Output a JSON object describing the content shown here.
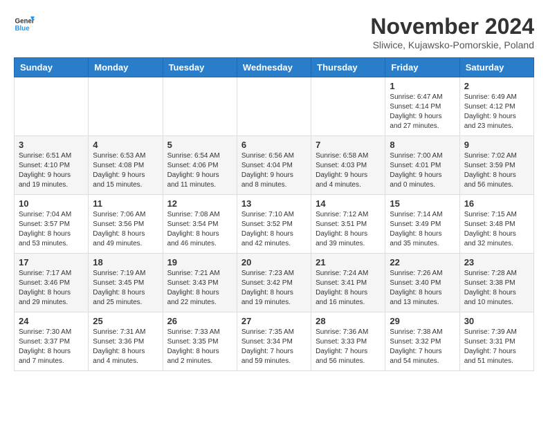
{
  "header": {
    "logo_line1": "General",
    "logo_line2": "Blue",
    "month_title": "November 2024",
    "location": "Sliwice, Kujawsko-Pomorskie, Poland"
  },
  "weekdays": [
    "Sunday",
    "Monday",
    "Tuesday",
    "Wednesday",
    "Thursday",
    "Friday",
    "Saturday"
  ],
  "weeks": [
    [
      {
        "day": "",
        "info": ""
      },
      {
        "day": "",
        "info": ""
      },
      {
        "day": "",
        "info": ""
      },
      {
        "day": "",
        "info": ""
      },
      {
        "day": "",
        "info": ""
      },
      {
        "day": "1",
        "info": "Sunrise: 6:47 AM\nSunset: 4:14 PM\nDaylight: 9 hours and 27 minutes."
      },
      {
        "day": "2",
        "info": "Sunrise: 6:49 AM\nSunset: 4:12 PM\nDaylight: 9 hours and 23 minutes."
      }
    ],
    [
      {
        "day": "3",
        "info": "Sunrise: 6:51 AM\nSunset: 4:10 PM\nDaylight: 9 hours and 19 minutes."
      },
      {
        "day": "4",
        "info": "Sunrise: 6:53 AM\nSunset: 4:08 PM\nDaylight: 9 hours and 15 minutes."
      },
      {
        "day": "5",
        "info": "Sunrise: 6:54 AM\nSunset: 4:06 PM\nDaylight: 9 hours and 11 minutes."
      },
      {
        "day": "6",
        "info": "Sunrise: 6:56 AM\nSunset: 4:04 PM\nDaylight: 9 hours and 8 minutes."
      },
      {
        "day": "7",
        "info": "Sunrise: 6:58 AM\nSunset: 4:03 PM\nDaylight: 9 hours and 4 minutes."
      },
      {
        "day": "8",
        "info": "Sunrise: 7:00 AM\nSunset: 4:01 PM\nDaylight: 9 hours and 0 minutes."
      },
      {
        "day": "9",
        "info": "Sunrise: 7:02 AM\nSunset: 3:59 PM\nDaylight: 8 hours and 56 minutes."
      }
    ],
    [
      {
        "day": "10",
        "info": "Sunrise: 7:04 AM\nSunset: 3:57 PM\nDaylight: 8 hours and 53 minutes."
      },
      {
        "day": "11",
        "info": "Sunrise: 7:06 AM\nSunset: 3:56 PM\nDaylight: 8 hours and 49 minutes."
      },
      {
        "day": "12",
        "info": "Sunrise: 7:08 AM\nSunset: 3:54 PM\nDaylight: 8 hours and 46 minutes."
      },
      {
        "day": "13",
        "info": "Sunrise: 7:10 AM\nSunset: 3:52 PM\nDaylight: 8 hours and 42 minutes."
      },
      {
        "day": "14",
        "info": "Sunrise: 7:12 AM\nSunset: 3:51 PM\nDaylight: 8 hours and 39 minutes."
      },
      {
        "day": "15",
        "info": "Sunrise: 7:14 AM\nSunset: 3:49 PM\nDaylight: 8 hours and 35 minutes."
      },
      {
        "day": "16",
        "info": "Sunrise: 7:15 AM\nSunset: 3:48 PM\nDaylight: 8 hours and 32 minutes."
      }
    ],
    [
      {
        "day": "17",
        "info": "Sunrise: 7:17 AM\nSunset: 3:46 PM\nDaylight: 8 hours and 29 minutes."
      },
      {
        "day": "18",
        "info": "Sunrise: 7:19 AM\nSunset: 3:45 PM\nDaylight: 8 hours and 25 minutes."
      },
      {
        "day": "19",
        "info": "Sunrise: 7:21 AM\nSunset: 3:43 PM\nDaylight: 8 hours and 22 minutes."
      },
      {
        "day": "20",
        "info": "Sunrise: 7:23 AM\nSunset: 3:42 PM\nDaylight: 8 hours and 19 minutes."
      },
      {
        "day": "21",
        "info": "Sunrise: 7:24 AM\nSunset: 3:41 PM\nDaylight: 8 hours and 16 minutes."
      },
      {
        "day": "22",
        "info": "Sunrise: 7:26 AM\nSunset: 3:40 PM\nDaylight: 8 hours and 13 minutes."
      },
      {
        "day": "23",
        "info": "Sunrise: 7:28 AM\nSunset: 3:38 PM\nDaylight: 8 hours and 10 minutes."
      }
    ],
    [
      {
        "day": "24",
        "info": "Sunrise: 7:30 AM\nSunset: 3:37 PM\nDaylight: 8 hours and 7 minutes."
      },
      {
        "day": "25",
        "info": "Sunrise: 7:31 AM\nSunset: 3:36 PM\nDaylight: 8 hours and 4 minutes."
      },
      {
        "day": "26",
        "info": "Sunrise: 7:33 AM\nSunset: 3:35 PM\nDaylight: 8 hours and 2 minutes."
      },
      {
        "day": "27",
        "info": "Sunrise: 7:35 AM\nSunset: 3:34 PM\nDaylight: 7 hours and 59 minutes."
      },
      {
        "day": "28",
        "info": "Sunrise: 7:36 AM\nSunset: 3:33 PM\nDaylight: 7 hours and 56 minutes."
      },
      {
        "day": "29",
        "info": "Sunrise: 7:38 AM\nSunset: 3:32 PM\nDaylight: 7 hours and 54 minutes."
      },
      {
        "day": "30",
        "info": "Sunrise: 7:39 AM\nSunset: 3:31 PM\nDaylight: 7 hours and 51 minutes."
      }
    ]
  ]
}
